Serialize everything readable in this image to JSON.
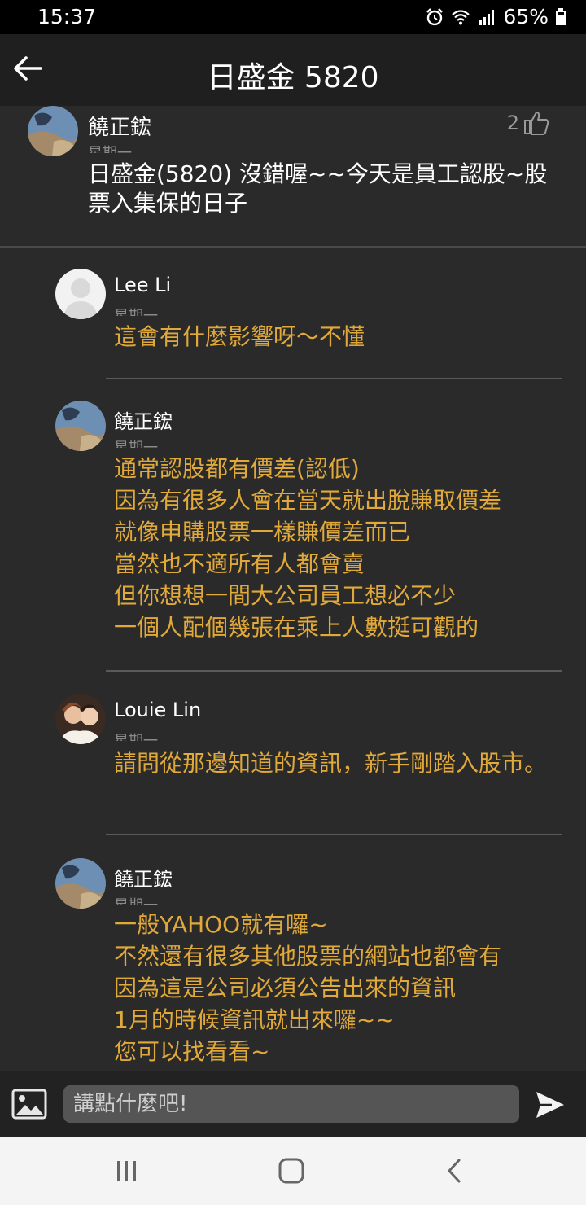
{
  "status_bar": {
    "time": "15:37",
    "battery": "65%"
  },
  "app_bar": {
    "title": "日盛金 5820"
  },
  "post": {
    "author": "饒正鋐",
    "date": "星期一",
    "likes": "2",
    "text": "日盛金(5820) 沒錯喔~~今天是員工認股~股票入集保的日子"
  },
  "replies": [
    {
      "author": "Lee Li",
      "date": "星期一",
      "text": "這會有什麼影響呀～不懂"
    },
    {
      "author": "饒正鋐",
      "date": "星期一",
      "text": "通常認股都有價差(認低)\n因為有很多人會在當天就出脫賺取價差\n就像申購股票一樣賺價差而已\n當然也不適所有人都會賣\n但你想想一間大公司員工想必不少\n一個人配個幾張在乘上人數挺可觀的"
    },
    {
      "author": "Louie Lin",
      "date": "星期一",
      "text": "請問從那邊知道的資訊，新手剛踏入股市。"
    },
    {
      "author": "饒正鋐",
      "date": "星期一",
      "text": "一般YAHOO就有囉~\n不然還有很多其他股票的網站也都會有\n因為這是公司必須公告出來的資訊\n1月的時候資訊就出來囉~~\n您可以找看看~"
    }
  ],
  "composer": {
    "placeholder": "講點什麼吧!"
  },
  "icons": {
    "back": "arrow-left-icon",
    "like": "thumbs-up-icon",
    "image": "image-icon",
    "send": "send-icon",
    "recent": "recent-apps-icon",
    "home": "home-icon",
    "nav_back": "chevron-left-icon"
  },
  "colors": {
    "reply_text": "#e0a93a",
    "background": "#2a2a2a"
  }
}
